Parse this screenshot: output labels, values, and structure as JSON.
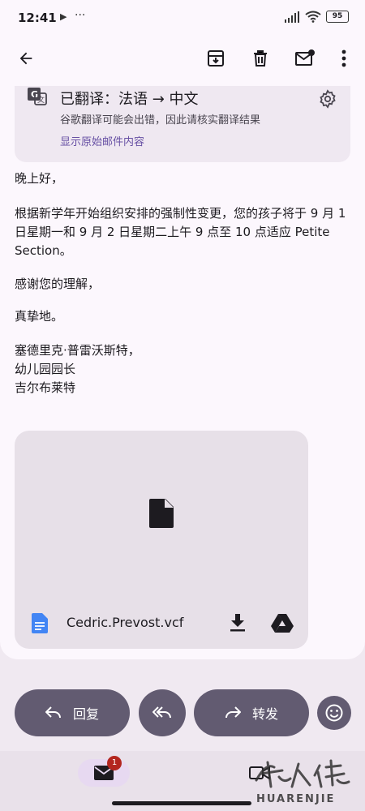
{
  "status_bar": {
    "time": "12:41",
    "battery": "95"
  },
  "app_bar": {
    "back_icon": "arrow-back-icon",
    "actions": [
      "archive-icon",
      "delete-icon",
      "mark-unread-icon",
      "more-vert-icon"
    ]
  },
  "translation": {
    "title": "已翻译：法语 → 中文",
    "disclaimer": "谷歌翻译可能会出错，因此请核实翻译结果",
    "show_original": "显示原始邮件内容"
  },
  "email": {
    "greeting": "晚上好，",
    "body": "根据新学年开始组织安排的强制性变更，您的孩子将于 9 月 1 日星期一和 9 月 2 日星期二上午 9 点至 10 点适应 Petite Section。",
    "thanks": "感谢您的理解，",
    "closing": "真挚地。",
    "signature_line1": "塞德里克·普雷沃斯特，",
    "signature_line2": "幼儿园园长",
    "signature_line3": "吉尔布莱特"
  },
  "attachment": {
    "filename": "Cedric.Prevost.vcf"
  },
  "actions": {
    "reply": "回复",
    "forward": "转发"
  },
  "bottom_nav": {
    "mail_badge": "1"
  },
  "watermark": {
    "text": "HUARENJIE"
  },
  "colors": {
    "accent": "#6750a4",
    "pill": "#625b71",
    "badge": "#b3261e",
    "drive_blue": "#4285f4"
  }
}
